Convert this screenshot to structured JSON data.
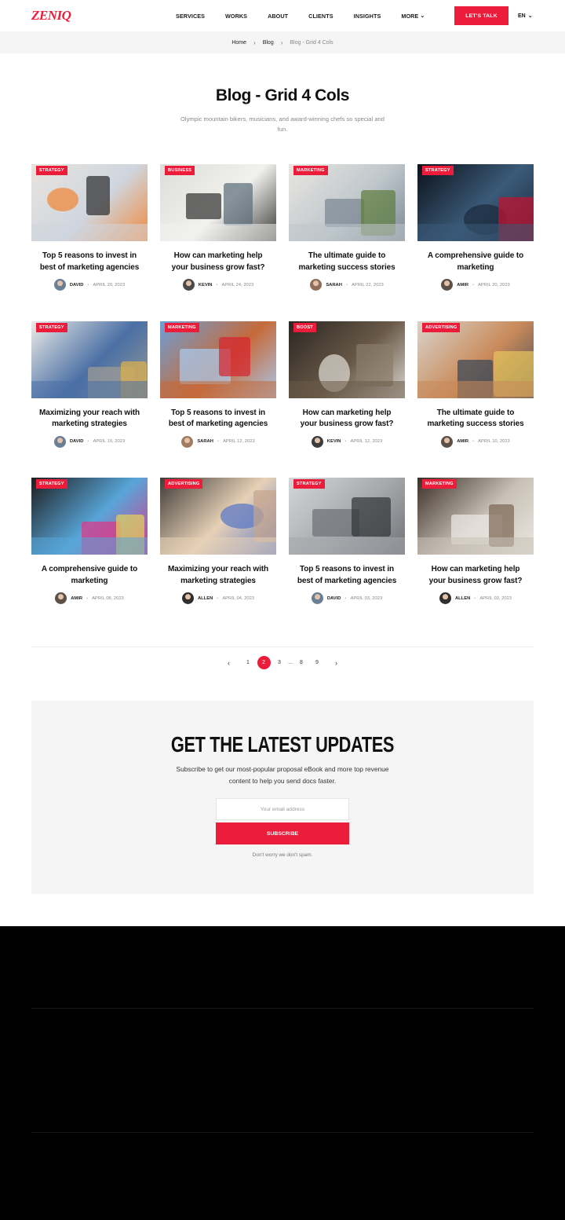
{
  "header": {
    "logo": "ZENIQ",
    "nav": [
      "SERVICES",
      "WORKS",
      "ABOUT",
      "CLIENTS",
      "INSIGHTS",
      "MORE"
    ],
    "cta": "LET'S TALK",
    "lang": "EN"
  },
  "breadcrumb": {
    "home": "Home",
    "blog": "Blog",
    "current": "Blog - Grid 4 Cols"
  },
  "page": {
    "title": "Blog - Grid 4 Cols",
    "subtitle": "Olympic mountain bikers, musicians, and award-winning chefs so special and fun."
  },
  "posts": [
    {
      "tag": "STRATEGY",
      "title": "Top 5 reasons to invest in best of marketing agencies",
      "author": "DAVID",
      "date": "APRIL 20, 2023"
    },
    {
      "tag": "BUSINESS",
      "title": "How can marketing help your business grow fast?",
      "author": "KEVIN",
      "date": "APRIL 24, 2023"
    },
    {
      "tag": "MARKETING",
      "title": "The ultimate guide to marketing success stories",
      "author": "SARAH",
      "date": "APRIL 22, 2023"
    },
    {
      "tag": "STRATEGY",
      "title": "A comprehensive guide to marketing",
      "author": "AMIR",
      "date": "APRIL 20, 2023"
    },
    {
      "tag": "STRATEGY",
      "title": "Maximizing your reach with marketing strategies",
      "author": "DAVID",
      "date": "APRIL 15, 2023"
    },
    {
      "tag": "MARKETING",
      "title": "Top 5 reasons to invest in best of marketing agencies",
      "author": "SARAH",
      "date": "APRIL 12, 2023"
    },
    {
      "tag": "BOOST",
      "title": "How can marketing help your business grow fast?",
      "author": "KEVIN",
      "date": "APRIL 12, 2023"
    },
    {
      "tag": "ADVERTISING",
      "title": "The ultimate guide to marketing success stories",
      "author": "AMIR",
      "date": "APRIL 10, 2023"
    },
    {
      "tag": "STRATEGY",
      "title": "A comprehensive guide to marketing",
      "author": "AMIR",
      "date": "APRIL 08, 2023"
    },
    {
      "tag": "ADVERTISING",
      "title": "Maximizing your reach with marketing strategies",
      "author": "ALLEN",
      "date": "APRIL 04, 2023"
    },
    {
      "tag": "STRATEGY",
      "title": "Top 5 reasons to invest in best of marketing agencies",
      "author": "DAVID",
      "date": "APRIL 03, 2023"
    },
    {
      "tag": "MARKETING",
      "title": "How can marketing help your business grow fast?",
      "author": "ALLEN",
      "date": "APRIL 03, 2023"
    }
  ],
  "pagination": {
    "pages": [
      "1",
      "2",
      "3",
      "...",
      "8",
      "9"
    ],
    "active": "2"
  },
  "newsletter": {
    "title": "GET THE LATEST UPDATES",
    "subtitle": "Subscribe to get our most-popular proposal eBook and more top revenue content to help you send docs faster.",
    "placeholder": "Your email address",
    "button": "SUBSCRIBE",
    "note": "Don't worry we don't spam."
  },
  "colors": {
    "accent": "#ec1c3b",
    "light_bg": "#f5f5f5",
    "footer_bg": "#000000"
  },
  "icons": {
    "chevron": "chevron-down-icon",
    "prev": "chevron-left-icon",
    "next": "chevron-right-icon",
    "breadcrumb_sep": "chevron-right-icon"
  }
}
